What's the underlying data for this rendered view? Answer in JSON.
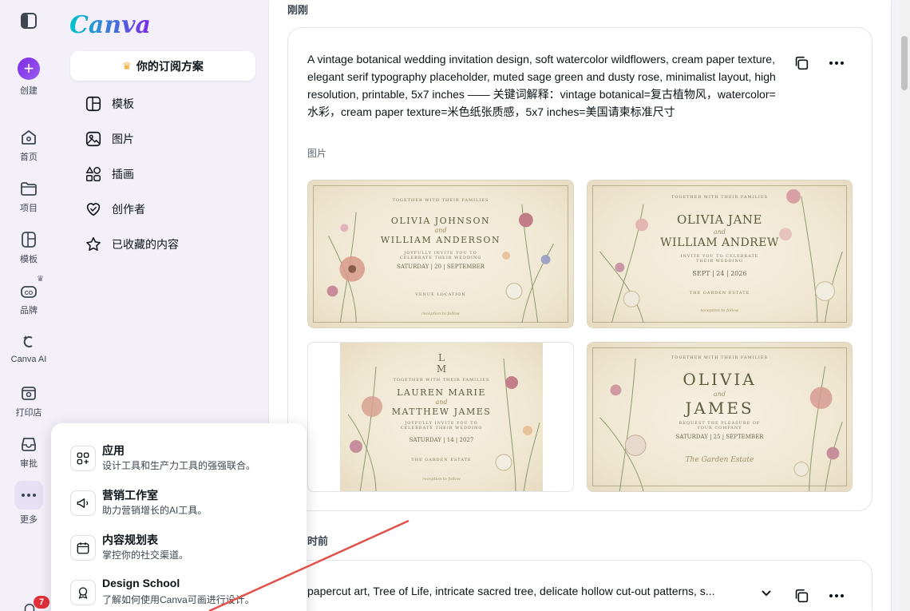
{
  "brand": {
    "logo": "Canva",
    "accent": "#7d2ae8",
    "annotation_color": "#e0524a"
  },
  "rail": {
    "items": [
      {
        "label": "创建",
        "icon": "plus-icon"
      },
      {
        "label": "首页",
        "icon": "home-icon"
      },
      {
        "label": "项目",
        "icon": "folder-icon"
      },
      {
        "label": "模板",
        "icon": "template-icon"
      },
      {
        "label": "品牌",
        "icon": "brand-icon"
      },
      {
        "label": "Canva AI",
        "icon": "canva-ai-icon"
      },
      {
        "label": "打印店",
        "icon": "print-shop-icon"
      },
      {
        "label": "审批",
        "icon": "inbox-icon"
      },
      {
        "label": "更多",
        "icon": "more-icon"
      }
    ],
    "notification_count": "7"
  },
  "panel": {
    "subscription_label": "你的订阅方案",
    "items": [
      {
        "label": "模板",
        "icon": "template-icon"
      },
      {
        "label": "图片",
        "icon": "image-icon"
      },
      {
        "label": "插画",
        "icon": "shapes-icon"
      },
      {
        "label": "创作者",
        "icon": "heart-icon"
      },
      {
        "label": "已收藏的内容",
        "icon": "star-icon"
      }
    ]
  },
  "main": {
    "section_top_label": "刚刚",
    "result": {
      "prompt": "A vintage botanical wedding invitation design, soft watercolor wildflowers, cream paper texture, elegant serif typography placeholder, muted sage green and dusty rose, minimalist layout, high resolution, printable, 5x7 inches —— 关键词解释：vintage botanical=复古植物风，watercolor=水彩，cream paper texture=米色纸张质感，5x7 inches=美国请柬标准尺寸",
      "type": "图片",
      "images": [
        {
          "header": "TOGETHER WITH THEIR FAMILIES",
          "name1": "OLIVIA JOHNSON",
          "and": "and",
          "name2": "WILLIAM ANDERSON",
          "line": "JOYFULLY INVITE YOU TO CELEBRATE THEIR WEDDING",
          "date": "SATURDAY | 20 | SEPTEMBER",
          "venue": "VENUE LOCATION",
          "footer": "reception to follow"
        },
        {
          "header": "TOGETHER WITH THEIR FAMILIES",
          "name1": "OLIVIA JANE",
          "and": "and",
          "name2": "WILLIAM ANDREW",
          "line": "INVITE YOU TO CELEBRATE THEIR WEDDING",
          "date": "SEPT | 24 | 2026",
          "venue": "THE GARDEN ESTATE",
          "footer": "reception to follow"
        },
        {
          "header": "TOGETHER WITH THEIR FAMILIES",
          "name1": "LAUREN MARIE",
          "and": "and",
          "name2": "MATTHEW JAMES",
          "line": "JOYFULLY INVITE YOU TO CELEBRATE THEIR WEDDING",
          "date": "SATURDAY | 14 | 2027",
          "venue": "THE GARDEN ESTATE",
          "footer": "reception to follow"
        },
        {
          "header": "TOGETHER WITH THEIR FAMILIES",
          "name1": "OLIVIA",
          "and": "and",
          "name2": "JAMES",
          "line": "REQUEST THE PLEASURE OF YOUR COMPANY",
          "date": "SATURDAY | 25 | SEPTEMBER",
          "venue": "The Garden Estate",
          "footer": ""
        }
      ]
    },
    "section_second_label": "时前",
    "second_prompt": "papercut art, Tree of Life, intricate sacred tree, delicate hollow cut-out patterns, s..."
  },
  "popup": {
    "items": [
      {
        "title": "应用",
        "desc": "设计工具和生产力工具的强强联合。",
        "icon": "apps-icon"
      },
      {
        "title": "营销工作室",
        "desc": "助力营销增长的AI工具。",
        "icon": "megaphone-icon"
      },
      {
        "title": "内容规划表",
        "desc": "掌控你的社交渠道。",
        "icon": "calendar-icon"
      },
      {
        "title": "Design School",
        "desc": "了解如何使用Canva可画进行设计。",
        "icon": "award-icon"
      }
    ]
  }
}
